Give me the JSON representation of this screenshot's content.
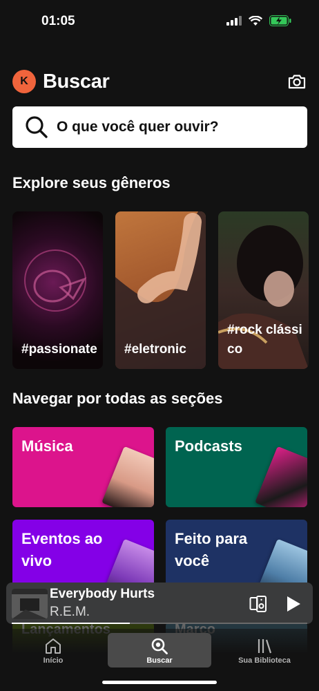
{
  "status_bar": {
    "time": "01:05"
  },
  "header": {
    "avatar_letter": "K",
    "title": "Buscar"
  },
  "search": {
    "placeholder": "O que você quer ouvir?"
  },
  "genres_section": {
    "title": "Explore seus gêneros",
    "items": [
      {
        "label": "#passionate"
      },
      {
        "label": "#eletronic"
      },
      {
        "label": "#rock clássico"
      }
    ]
  },
  "browse_section": {
    "title": "Navegar por todas as seções",
    "items": [
      {
        "label": "Música",
        "color": "#dc148c"
      },
      {
        "label": "Podcasts",
        "color": "#006450"
      },
      {
        "label": "Eventos ao vivo",
        "color": "#8400e7"
      },
      {
        "label": "Feito para você",
        "color": "#1e3264"
      }
    ],
    "faded_items": [
      {
        "label": "Lançamentos",
        "color": "#608108"
      },
      {
        "label": "Março",
        "color": "#477d95"
      }
    ]
  },
  "now_playing": {
    "title": "Everybody Hurts",
    "artist": "R.E.M.",
    "progress": 0.4
  },
  "bottom_nav": {
    "items": [
      {
        "label": "Início"
      },
      {
        "label": "Buscar"
      },
      {
        "label": "Sua Biblioteca"
      }
    ]
  },
  "colors": {
    "background": "#121212",
    "avatar": "#f0643c",
    "battery": "#34c759"
  }
}
